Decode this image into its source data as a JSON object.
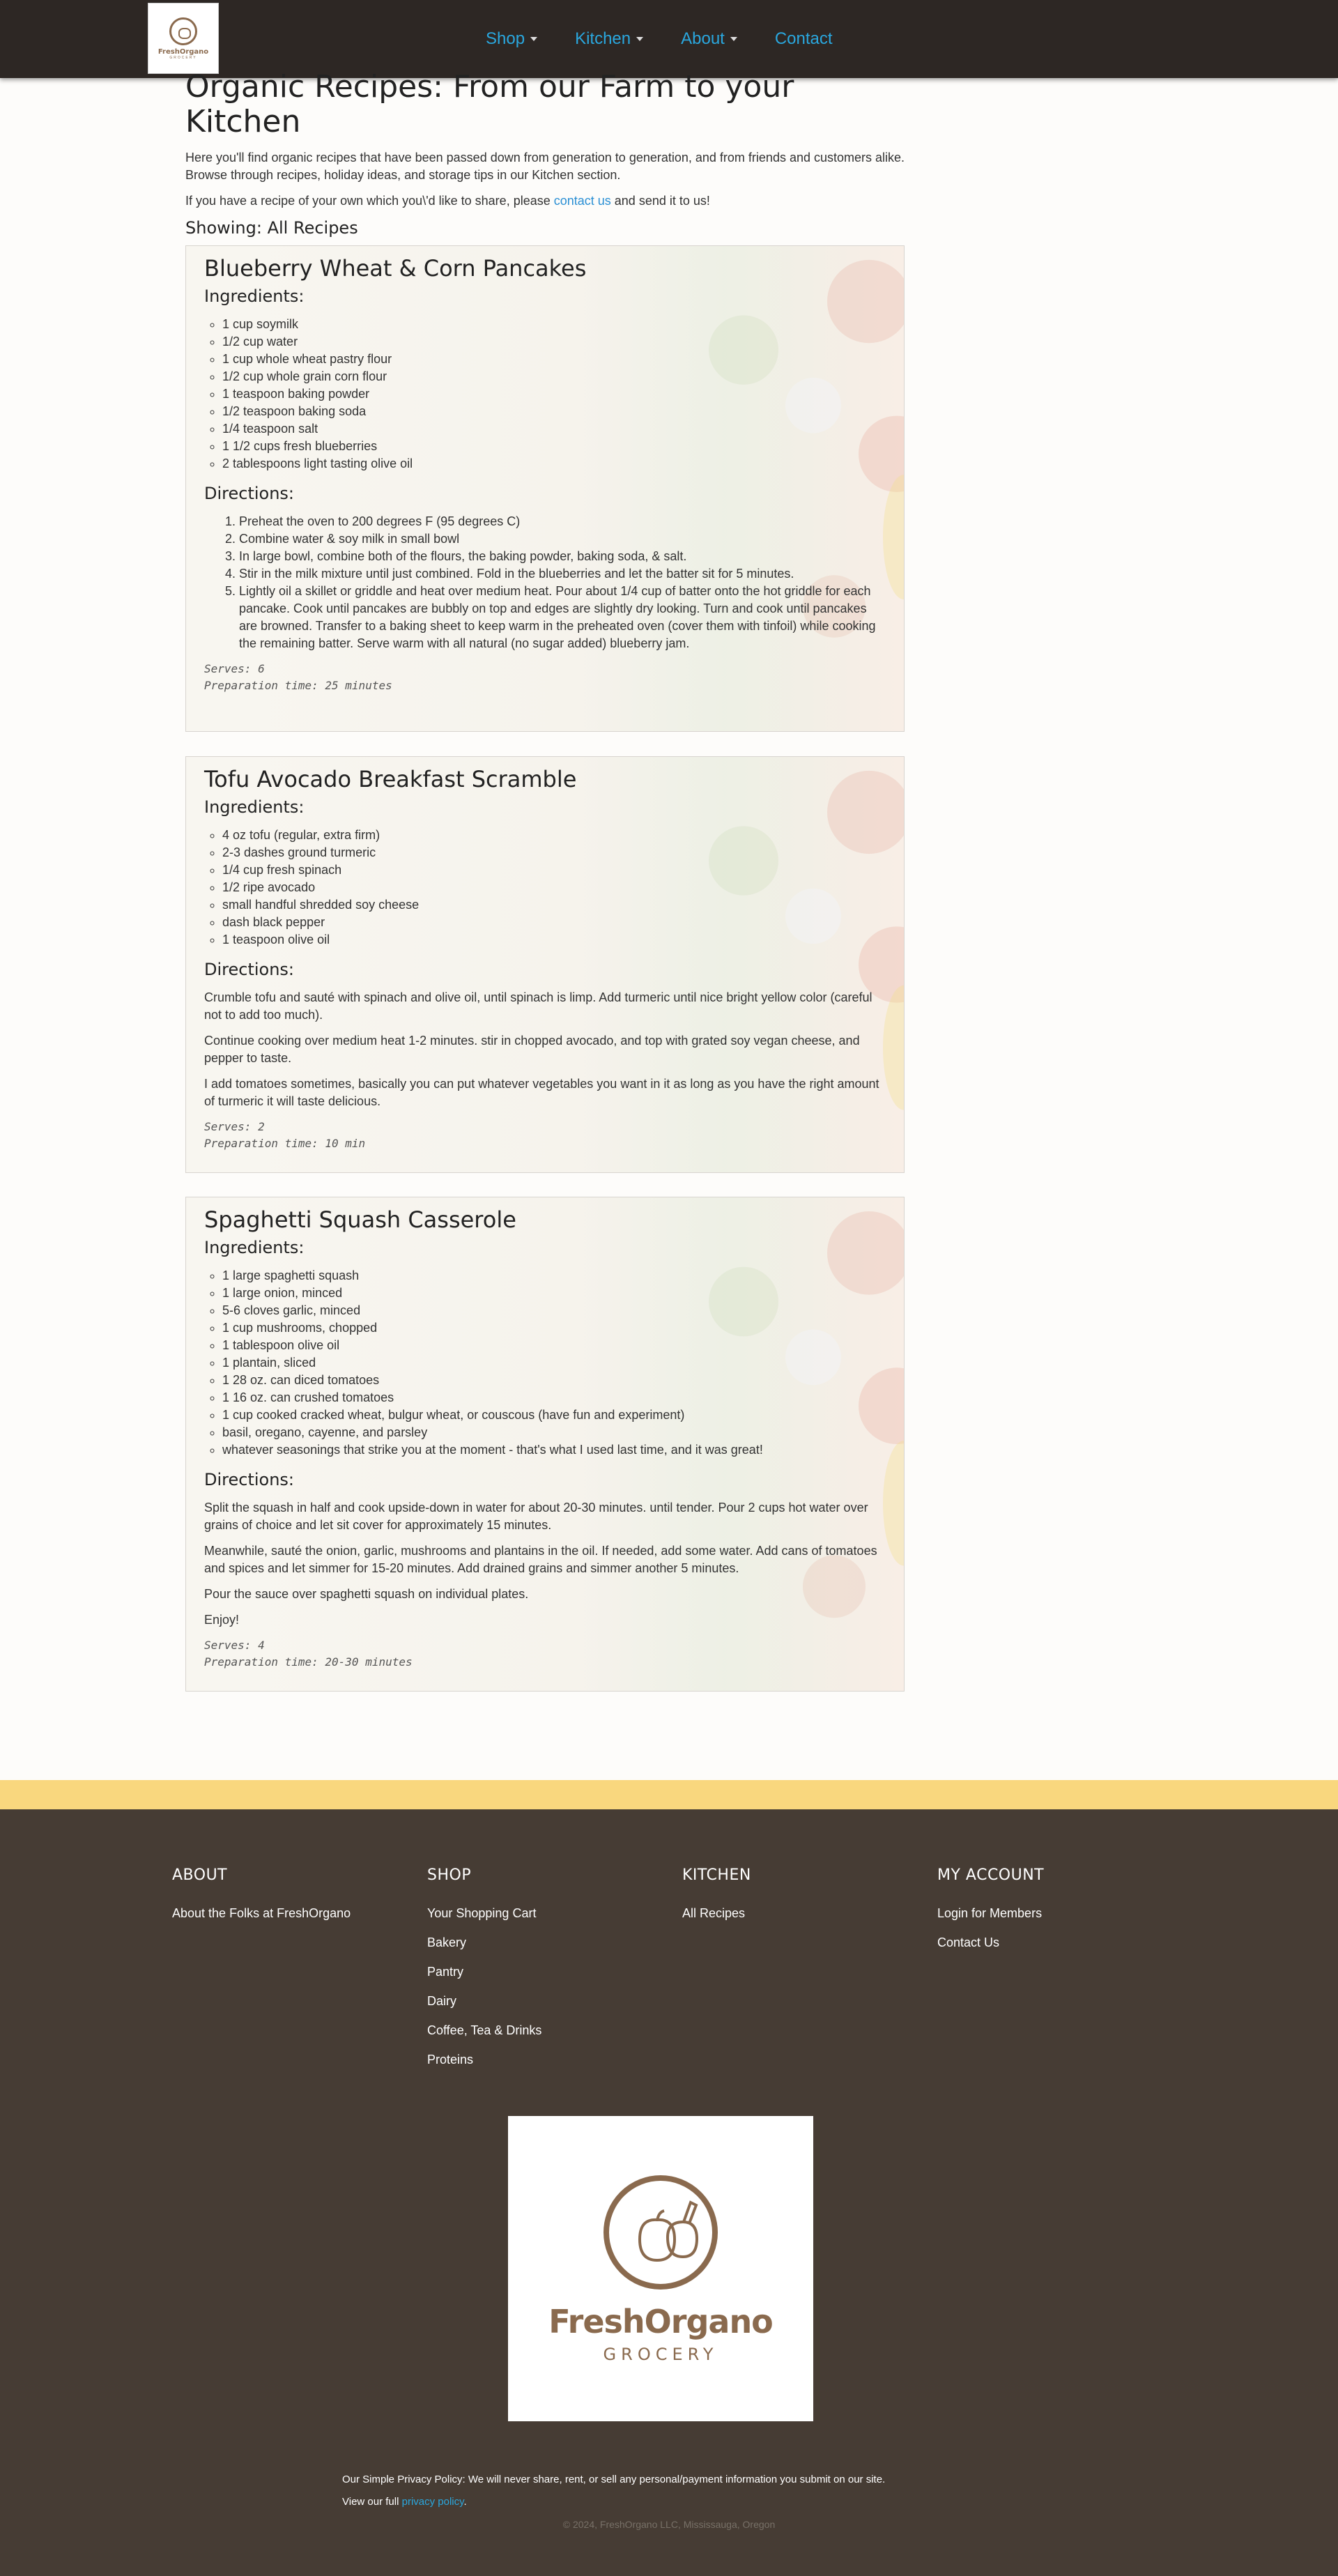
{
  "nav": {
    "logo_brand": "FreshOrgano",
    "logo_sub": "GROCERY",
    "items": [
      {
        "label": "Shop",
        "dropdown": true
      },
      {
        "label": "Kitchen",
        "dropdown": true
      },
      {
        "label": "About",
        "dropdown": true
      },
      {
        "label": "Contact",
        "dropdown": false
      }
    ]
  },
  "page": {
    "title": "Organic Recipes: From our Farm to your Kitchen",
    "intro": "Here you'll find organic recipes that have been passed down from generation to generation, and from friends and customers alike. Browse through recipes, holiday ideas, and storage tips in our Kitchen section.",
    "share_before": "If you have a recipe of your own which you\\'d like to share, please ",
    "share_link": "contact us",
    "share_after": " and send it to us!",
    "showing": "Showing: All Recipes",
    "ingredients_heading": "Ingredients:",
    "directions_heading": "Directions:"
  },
  "recipes": [
    {
      "title": "Blueberry Wheat & Corn Pancakes",
      "ingredients": [
        "1 cup soymilk",
        "1/2 cup water",
        "1 cup whole wheat pastry flour",
        "1/2 cup whole grain corn flour",
        "1 teaspoon baking powder",
        "1/2 teaspoon baking soda",
        "1/4 teaspoon salt",
        "1 1/2 cups fresh blueberries",
        "2 tablespoons light tasting olive oil"
      ],
      "directions_ordered": [
        "Preheat the oven to 200 degrees F (95 degrees C)",
        "Combine water & soy milk in small bowl",
        "In large bowl, combine both of the flours, the baking powder, baking soda, & salt.",
        "Stir in the milk mixture until just combined. Fold in the blueberries and let the batter sit for 5 minutes.",
        "Lightly oil a skillet or griddle and heat over medium heat. Pour about 1/4 cup of batter onto the hot griddle for each pancake. Cook until pancakes are bubbly on top and edges are slightly dry looking. Turn and cook until pancakes are browned. Transfer to a baking sheet to keep warm in the preheated oven (cover them with tinfoil) while cooking the remaining batter. Serve warm with all natural (no sugar added) blueberry jam."
      ],
      "serves": "Serves: 6",
      "prep": "Preparation time: 25 minutes"
    },
    {
      "title": "Tofu Avocado Breakfast Scramble",
      "ingredients": [
        "4 oz tofu (regular, extra firm)",
        "2-3 dashes ground turmeric",
        "1/4 cup fresh spinach",
        "1/2 ripe avocado",
        "small handful shredded soy cheese",
        "dash black pepper",
        "1 teaspoon olive oil"
      ],
      "directions_paragraphs": [
        "Crumble tofu and sauté with spinach and olive oil, until spinach is limp. Add turmeric until nice bright yellow color (careful not to add too much).",
        "Continue cooking over medium heat 1-2 minutes. stir in chopped avocado, and top with grated soy vegan cheese, and pepper to taste.",
        "I add tomatoes sometimes, basically you can put whatever vegetables you want in it as long as you have the right amount of turmeric it will taste delicious."
      ],
      "serves": "Serves: 2",
      "prep": "Preparation time: 10 min"
    },
    {
      "title": "Spaghetti Squash Casserole",
      "ingredients": [
        "1 large spaghetti squash",
        "1 large onion, minced",
        "5-6 cloves garlic, minced",
        "1 cup mushrooms, chopped",
        "1 tablespoon olive oil",
        "1 plantain, sliced",
        "1 28 oz. can diced tomatoes",
        "1 16 oz. can crushed tomatoes",
        "1 cup cooked cracked wheat, bulgur wheat, or couscous (have fun and experiment)",
        "basil, oregano, cayenne, and parsley",
        "whatever seasonings that strike you at the moment - that's what I used last time, and it was great!"
      ],
      "directions_paragraphs": [
        "Split the squash in half and cook upside-down in water for about 20-30 minutes. until tender. Pour 2 cups hot water over grains of choice and let sit cover for approximately 15 minutes.",
        "Meanwhile, sauté the onion, garlic, mushrooms and plantains in the oil. If needed, add some water. Add cans of tomatoes and spices and let simmer for 15-20 minutes. Add drained grains and simmer another 5 minutes.",
        "Pour the sauce over spaghetti squash on individual plates.",
        "Enjoy!"
      ],
      "serves": "Serves: 4",
      "prep": "Preparation time: 20-30 minutes"
    }
  ],
  "footer": {
    "columns": [
      {
        "heading": "ABOUT",
        "links": [
          "About the Folks at FreshOrgano"
        ]
      },
      {
        "heading": "SHOP",
        "links": [
          "Your Shopping Cart",
          "Bakery",
          "Pantry",
          "Dairy",
          "Coffee, Tea & Drinks",
          "Proteins"
        ]
      },
      {
        "heading": "KITCHEN",
        "links": [
          "All Recipes"
        ]
      },
      {
        "heading": "MY ACCOUNT",
        "links": [
          "Login for Members",
          "Contact Us"
        ]
      }
    ],
    "logo_name": "FreshOrgano",
    "logo_tag": "GROCERY",
    "privacy_line": "Our Simple Privacy Policy: We will never share, rent, or sell any personal/payment information you submit on our site.",
    "privacy_view": "View our full ",
    "privacy_link": "privacy policy",
    "privacy_end": ".",
    "copyright": "© 2024, FreshOrgano LLC, Mississauga, Oregon"
  },
  "colors": {
    "nav_bg": "#2d2724",
    "accent": "#2aa7de",
    "footer_bg": "#463c34",
    "footer_band": "#f9d77e",
    "brand": "#8a6a4e"
  }
}
